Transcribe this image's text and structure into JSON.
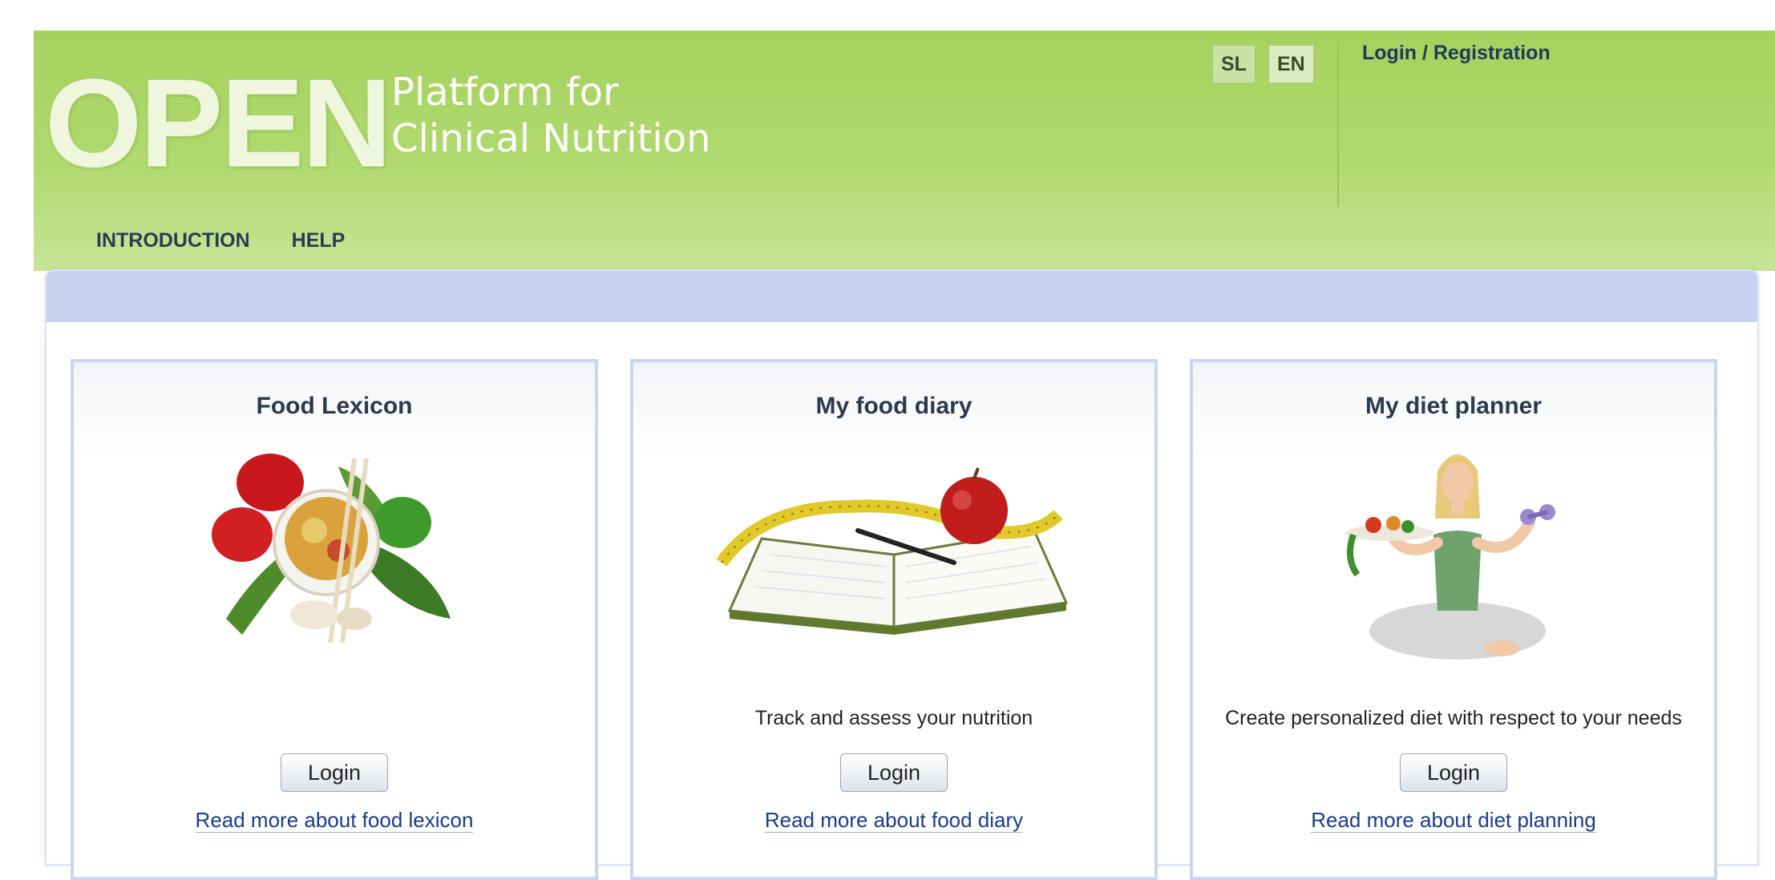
{
  "header": {
    "logo": "OPEN",
    "subtitle_line1": "Platform for",
    "subtitle_line2": "Clinical Nutrition",
    "lang_sl": "SL",
    "lang_en": "EN",
    "login_registration": "Login / Registration"
  },
  "nav": {
    "items": [
      "INTRODUCTION",
      "HELP"
    ]
  },
  "cards": [
    {
      "title": "Food Lexicon",
      "description": "",
      "button": "Login",
      "link": "Read more about food lexicon",
      "image": "vegetables-bowl-image"
    },
    {
      "title": "My food diary",
      "description": "Track and assess your nutrition",
      "button": "Login",
      "link": "Read more about food diary",
      "image": "diary-apple-tape-image"
    },
    {
      "title": "My diet planner",
      "description": "Create personalized diet with respect to your needs",
      "button": "Login",
      "link": "Read more about diet planning",
      "image": "woman-diet-image"
    }
  ],
  "colors": {
    "header_green": "#a4d25d",
    "bar_blue": "#c5d3f0",
    "link_blue": "#1a3d86"
  }
}
